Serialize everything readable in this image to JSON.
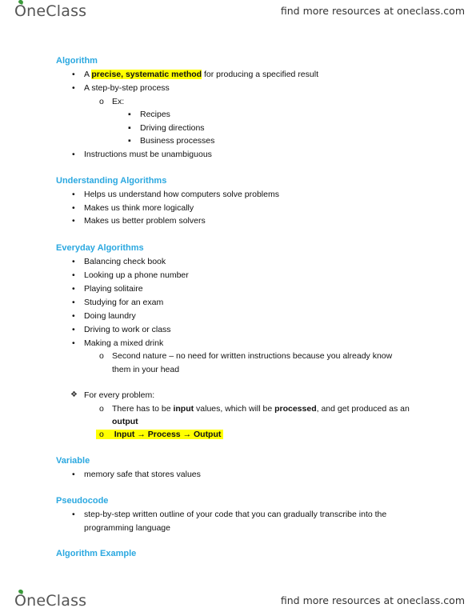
{
  "header": {
    "logo": "OneClass",
    "tagline": "find more resources at oneclass.com"
  },
  "footer": {
    "logo": "OneClass",
    "tagline": "find more resources at oneclass.com"
  },
  "colors": {
    "heading": "#2ba8e0",
    "highlight": "#ffff00",
    "logo_leaf": "#3a9a3a"
  },
  "icons": {
    "bullet": "•",
    "sub_bullet": "o",
    "square_bullet": "▪",
    "diamond_bullet": "❖",
    "arrow": "→"
  },
  "sections": {
    "algorithm": {
      "heading": "Algorithm",
      "item1_pre": "A ",
      "item1_highlight": "precise, systematic method",
      "item1_post": " for producing a specified result",
      "item2": "A step-by-step process",
      "ex": "Ex:",
      "examples": [
        "Recipes",
        "Driving directions",
        "Business processes"
      ],
      "item3": "Instructions must be unambiguous"
    },
    "understanding": {
      "heading": "Understanding Algorithms",
      "items": [
        "Helps us understand how computers solve problems",
        "Makes us think more logically",
        "Makes us better problem solvers"
      ]
    },
    "everyday": {
      "heading": "Everyday Algorithms",
      "items": [
        "Balancing check book",
        "Looking up a phone number",
        "Playing solitaire",
        "Studying for an exam",
        "Doing laundry",
        "Driving to work or class",
        "Making a mixed drink"
      ],
      "sub_line1": "Second nature – no need for written instructions because you already know",
      "sub_line2": "them in your head"
    },
    "every_problem": {
      "label": "For every problem:",
      "line1_a": "There has to be ",
      "line1_b": "input",
      "line1_c": " values, which will be ",
      "line1_d": "processed",
      "line1_e": ", and get produced as an",
      "line2": "output",
      "flow_input": "Input",
      "flow_process": "Process",
      "flow_output": "Output"
    },
    "variable": {
      "heading": "Variable",
      "item": "memory safe that stores values"
    },
    "pseudocode": {
      "heading": "Pseudocode",
      "line1": "step-by-step written outline of your code that you can gradually transcribe into the",
      "line2": "programming language"
    },
    "algorithm_example": {
      "heading": "Algorithm Example"
    }
  }
}
